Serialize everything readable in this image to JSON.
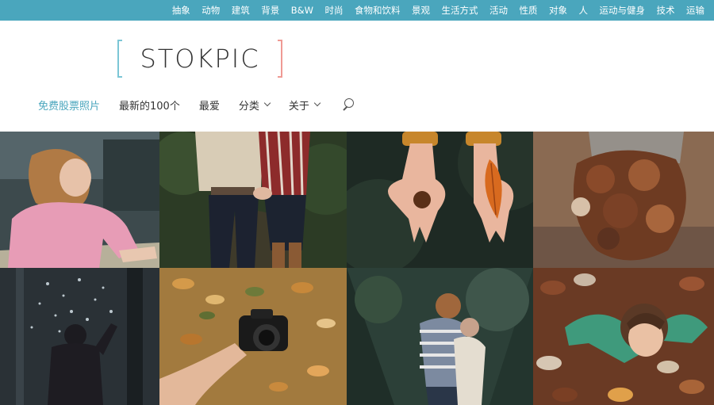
{
  "categories": [
    "抽象",
    "动物",
    "建筑",
    "背景",
    "B&W",
    "时尚",
    "食物和饮料",
    "景观",
    "生活方式",
    "活动",
    "性质",
    "对象",
    "人",
    "运动与健身",
    "技术",
    "运输"
  ],
  "logo": {
    "text": "STOKPIC"
  },
  "nav": {
    "items": [
      {
        "label": "免费股票照片",
        "active": true,
        "dropdown": false
      },
      {
        "label": "最新的100个",
        "active": false,
        "dropdown": false
      },
      {
        "label": "最爱",
        "active": false,
        "dropdown": false
      },
      {
        "label": "分类",
        "active": false,
        "dropdown": true
      },
      {
        "label": "关于",
        "active": false,
        "dropdown": true
      }
    ],
    "search_icon": "search-icon"
  },
  "colors": {
    "accent": "#4aa6bd",
    "logo_left_bracket": "#7cc6d6",
    "logo_right_bracket": "#ef9a94"
  },
  "photos": [
    "woman-writing-pink-sweater",
    "couple-holding-hands",
    "hands-holding-chestnut-and-leaf",
    "armful-of-autumn-leaves",
    "person-throwing-snow",
    "hand-holding-camera-over-leaves",
    "couple-embracing-in-forest",
    "child-lying-in-leaves"
  ]
}
